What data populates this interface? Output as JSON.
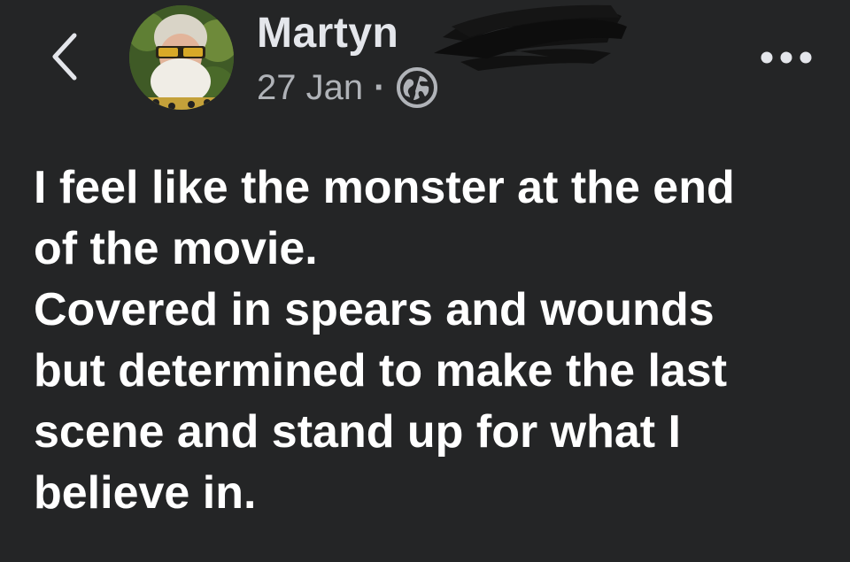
{
  "post": {
    "author": {
      "name": "Martyn"
    },
    "date": "27 Jan",
    "separator": "·",
    "visibility_icon": "globe-icon",
    "text_lines": [
      "I feel like the monster at the end",
      "of the movie.",
      "Covered in spears and wounds",
      "but determined to make the last",
      "scene and stand up for what I",
      "believe in."
    ]
  },
  "header": {
    "back_icon": "chevron-left-icon",
    "more_icon": "more-horizontal-icon"
  },
  "colors": {
    "background": "#242526",
    "primary_text": "#ffffff",
    "secondary_text": "#b0b3b8"
  }
}
